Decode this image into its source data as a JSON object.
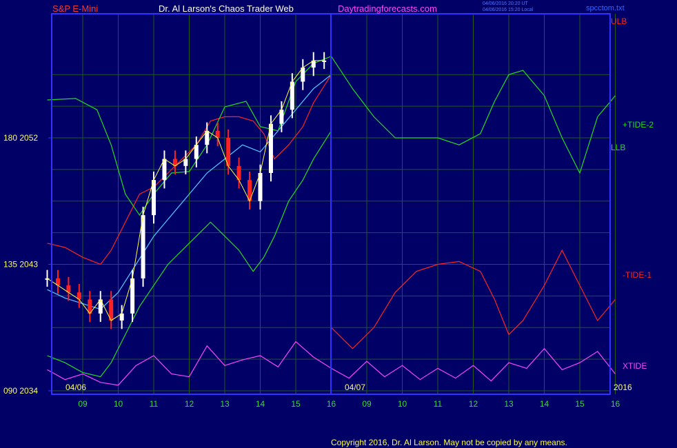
{
  "header": {
    "symbol": "S&P E-Mini",
    "title": "Dr. Al Larson's Chaos Trader Web",
    "site": "Daytradingforecasts.com",
    "timestamp_ut": "04/06/2016 20:20 UT",
    "timestamp_local": "04/06/2016 15:20 Local",
    "file": "spcctom.txt"
  },
  "copyright": "Copyright 2016, Dr. Al Larson. May not be copied by any means.",
  "colors": {
    "background": "#000066",
    "axis": "#3333ff",
    "grid": "#1f5a1f",
    "red": "#ff2222",
    "green": "#22dd22",
    "magenta": "#ff44ff",
    "cyan": "#55ccff",
    "yellow": "#ffff44",
    "white": "#ffffff"
  },
  "chart_data": {
    "type": "line",
    "title": "S&P E-Mini",
    "x_hour_labels": [
      "09",
      "10",
      "11",
      "12",
      "13",
      "14",
      "15",
      "16",
      "09",
      "10",
      "11",
      "12",
      "13",
      "14",
      "15",
      "16"
    ],
    "date_labels": [
      "04/06",
      "04/07"
    ],
    "year_label": "2016",
    "y_labels": [
      {
        "label": "180  2052",
        "price": 2052
      },
      {
        "label": "135  2043",
        "price": 2043
      },
      {
        "label": "090  2034",
        "price": 2034
      }
    ],
    "ylim": [
      2034,
      2052
    ],
    "grid": true,
    "right_labels": [
      {
        "text": "ULB",
        "color": "#ff2222"
      },
      {
        "text": "+TIDE-2",
        "color": "#22dd22"
      },
      {
        "text": "LLB",
        "color": "#22dd22"
      },
      {
        "text": "-TIDE-1",
        "color": "#ff2222"
      },
      {
        "text": "XTIDE",
        "color": "#ff44ff"
      }
    ],
    "price_series": {
      "name": "",
      "x": [
        0,
        0.3,
        0.6,
        0.9,
        1.2,
        1.5,
        1.8,
        2.1,
        2.4,
        2.7,
        3.0,
        3.3,
        3.6,
        3.9,
        4.2,
        4.5,
        4.8,
        5.1,
        5.4,
        5.7,
        6.0,
        6.3,
        6.6,
        6.9,
        7.2,
        7.5,
        7.8
      ],
      "close": [
        2042.0,
        2041.5,
        2041.0,
        2040.5,
        2039.5,
        2040.5,
        2039.0,
        2039.5,
        2042.0,
        2046.5,
        2049.0,
        2050.5,
        2050.0,
        2050.5,
        2051.5,
        2052.5,
        2052.0,
        2050.0,
        2049.0,
        2047.5,
        2049.5,
        2053.0,
        2054.0,
        2056.0,
        2057.0,
        2057.5,
        2057.5
      ]
    },
    "series": [
      {
        "name": "ULB",
        "color": "#ff2222",
        "x": [
          0,
          0.5,
          1,
          1.5,
          1.8,
          2.2,
          2.6,
          3.0,
          3.4,
          3.8,
          4.2,
          4.6,
          5.0,
          5.4,
          5.8,
          6.1,
          6.4,
          6.8,
          7.2,
          7.5,
          8.0
        ],
        "y": [
          2044.5,
          2044.2,
          2043.5,
          2043,
          2044,
          2046,
          2048,
          2048.5,
          2049.5,
          2050.5,
          2051.5,
          2053.2,
          2053.5,
          2053.5,
          2053.2,
          2052.3,
          2050.5,
          2051.5,
          2052.8,
          2054.5,
          2056.5
        ]
      },
      {
        "name": "LLB",
        "color": "#22dd22",
        "x": [
          0,
          0.5,
          1,
          1.5,
          1.8,
          2.2,
          2.6,
          3.0,
          3.4,
          3.8,
          4.2,
          4.6,
          5.0,
          5.4,
          5.8,
          6.1,
          6.4,
          6.8,
          7.2,
          7.5,
          8.0
        ],
        "y": [
          2036.5,
          2036,
          2035.3,
          2035,
          2036,
          2038,
          2040,
          2041.5,
          2043,
          2044,
          2045,
          2046,
          2045,
          2044,
          2042.5,
          2043.5,
          2045,
          2047.5,
          2049,
          2050.5,
          2052.5
        ]
      },
      {
        "name": "EMA",
        "color": "#55ccff",
        "x": [
          0,
          0.5,
          1,
          1.5,
          2.0,
          2.5,
          3.0,
          3.5,
          4.0,
          4.5,
          5.0,
          5.5,
          6.0,
          6.5,
          7.0,
          7.5,
          8.0
        ],
        "y": [
          2041.2,
          2040.6,
          2040.2,
          2039.8,
          2041,
          2043,
          2045,
          2046.5,
          2048,
          2049.5,
          2050.5,
          2051.5,
          2051,
          2052.5,
          2054,
          2055.5,
          2056.5
        ]
      },
      {
        "name": "+TIDE-2",
        "color": "#22dd22",
        "x": [
          0,
          0.8,
          1.4,
          1.8,
          2.2,
          2.6,
          3.0,
          3.5,
          4.0,
          4.5,
          5.0,
          5.6,
          6.0,
          6.5,
          7.0,
          7.5,
          8.0,
          8.6,
          9.2,
          9.8,
          10.4,
          11.0,
          11.6,
          12.2,
          12.6,
          13.0,
          13.4,
          14.0,
          14.5,
          15.0,
          15.5,
          16.0
        ],
        "y": [
          2054.7,
          2054.8,
          2054,
          2051.5,
          2048,
          2046.5,
          2048,
          2049.5,
          2049.6,
          2051.5,
          2054.2,
          2054.6,
          2052.8,
          2052.5,
          2056.0,
          2057.3,
          2057.8,
          2055.5,
          2053.5,
          2052.0,
          2052.0,
          2052.0,
          2051.5,
          2052.3,
          2054.6,
          2056.5,
          2056.8,
          2055.0,
          2052.0,
          2049.5,
          2053.5,
          2055.0
        ]
      },
      {
        "name": "-TIDE-1",
        "color": "#ff2222",
        "x": [
          8.0,
          8.6,
          9.2,
          9.8,
          10.4,
          11.0,
          11.6,
          12.2,
          12.6,
          13.0,
          13.4,
          14.0,
          14.5,
          15.0,
          15.5,
          16.0
        ],
        "y": [
          2038.5,
          2037.0,
          2038.5,
          2041.0,
          2042.5,
          2043.0,
          2043.2,
          2042.5,
          2040.5,
          2038.0,
          2039.0,
          2041.5,
          2044.0,
          2041.5,
          2039.0,
          2040.5
        ]
      },
      {
        "name": "XTIDE",
        "color": "#ff44ff",
        "x": [
          0,
          0.5,
          1.0,
          1.5,
          2.0,
          2.5,
          3.0,
          3.5,
          4.0,
          4.5,
          5.0,
          5.5,
          6.0,
          6.5,
          7.0,
          7.5,
          8.0,
          8.5,
          9.0,
          9.5,
          10.0,
          10.5,
          11.0,
          11.5,
          12.0,
          12.5,
          13.0,
          13.5,
          14.0,
          14.5,
          15.0,
          15.5,
          16.0
        ],
        "y": [
          2035.5,
          2034.8,
          2035.2,
          2034.6,
          2034.4,
          2035.8,
          2036.5,
          2035.2,
          2035.0,
          2037.2,
          2035.8,
          2036.2,
          2036.5,
          2035.7,
          2037.5,
          2036.4,
          2035.6,
          2034.9,
          2036.1,
          2035.0,
          2035.8,
          2034.8,
          2035.6,
          2034.9,
          2035.8,
          2034.7,
          2036.0,
          2035.6,
          2037.0,
          2035.5,
          2036.0,
          2036.8,
          2035.2
        ]
      }
    ]
  }
}
